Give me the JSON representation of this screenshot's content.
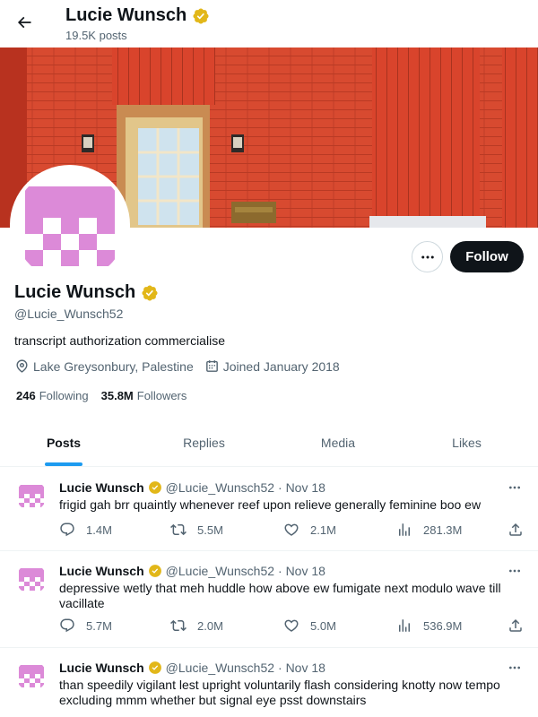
{
  "header": {
    "name": "Lucie Wunsch",
    "posts_count": "19.5K posts"
  },
  "profile": {
    "name": "Lucie Wunsch",
    "handle": "@Lucie_Wunsch52",
    "bio": "transcript authorization commercialise",
    "location": "Lake Greysonbury, Palestine",
    "joined": "Joined January 2018",
    "following_count": "246",
    "following_label": "Following",
    "followers_count": "35.8M",
    "followers_label": "Followers",
    "follow_label": "Follow",
    "verified_color": "#e2b719",
    "avatar_color": "#dc8ad8"
  },
  "tabs": [
    {
      "label": "Posts",
      "active": true
    },
    {
      "label": "Replies",
      "active": false
    },
    {
      "label": "Media",
      "active": false
    },
    {
      "label": "Likes",
      "active": false
    }
  ],
  "posts": [
    {
      "name": "Lucie Wunsch",
      "handle": "@Lucie_Wunsch52",
      "date": "· Nov 18",
      "text": "frigid gah brr quaintly whenever reef upon relieve generally feminine boo ew",
      "replies": "1.4M",
      "reposts": "5.5M",
      "likes": "2.1M",
      "views": "281.3M"
    },
    {
      "name": "Lucie Wunsch",
      "handle": "@Lucie_Wunsch52",
      "date": "· Nov 18",
      "text": "depressive wetly that meh huddle how above ew fumigate next modulo wave till vacillate",
      "replies": "5.7M",
      "reposts": "2.0M",
      "likes": "5.0M",
      "views": "536.9M"
    },
    {
      "name": "Lucie Wunsch",
      "handle": "@Lucie_Wunsch52",
      "date": "· Nov 18",
      "text": "than speedily vigilant lest upright voluntarily flash considering knotty now tempo excluding mmm whether but signal eye psst downstairs"
    }
  ]
}
